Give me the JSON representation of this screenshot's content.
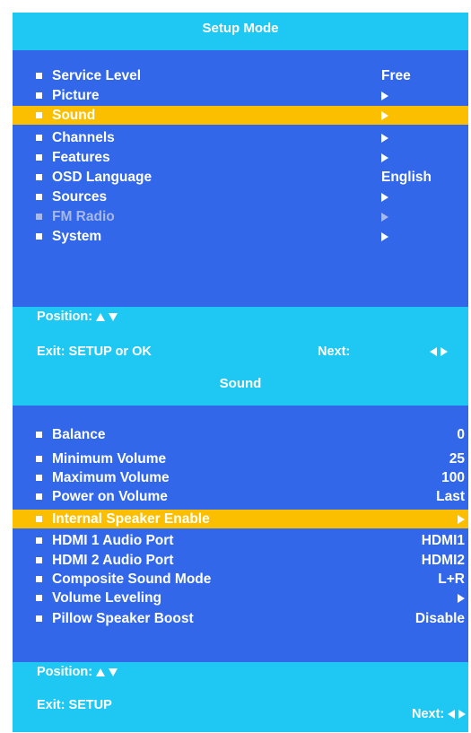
{
  "setup_menu": {
    "title": "Setup Mode",
    "items": [
      {
        "label": "Service Level",
        "value": "Free"
      },
      {
        "label": "Picture",
        "value": "",
        "arrow": true
      },
      {
        "label": "Sound",
        "value": "",
        "arrow": true,
        "selected": true
      },
      {
        "label": "Channels",
        "value": "",
        "arrow": true
      },
      {
        "label": "Features",
        "value": "",
        "arrow": true
      },
      {
        "label": "OSD Language",
        "value": "English"
      },
      {
        "label": "Sources",
        "value": "",
        "arrow": true
      },
      {
        "label": "FM Radio",
        "value": "",
        "arrow": true,
        "disabled": true
      },
      {
        "label": "System",
        "value": "",
        "arrow": true
      }
    ],
    "footer": {
      "position_label": "Position:",
      "exit_label": "Exit: SETUP or OK",
      "next_label": "Next:"
    }
  },
  "sound_menu": {
    "title": "Sound",
    "items": [
      {
        "label": "Balance",
        "value": "0"
      },
      {
        "label": "Minimum Volume",
        "value": "25"
      },
      {
        "label": "Maximum Volume",
        "value": "100"
      },
      {
        "label": "Power on Volume",
        "value": "Last"
      },
      {
        "label": "Internal Speaker Enable",
        "value": "",
        "arrow": true,
        "selected": true
      },
      {
        "label": "HDMI 1 Audio Port",
        "value": "HDMI1"
      },
      {
        "label": "HDMI 2 Audio Port",
        "value": "HDMI2"
      },
      {
        "label": "Composite Sound Mode",
        "value": "L+R"
      },
      {
        "label": "Volume Leveling",
        "value": "",
        "arrow": true
      },
      {
        "label": "Pillow Speaker Boost",
        "value": "Disable"
      }
    ],
    "footer": {
      "position_label": "Position:",
      "exit_label": "Exit: SETUP",
      "next_label": "Next:"
    }
  },
  "colors": {
    "header": "#1fc8f2",
    "body": "#3167e8",
    "highlight": "#fcbf00",
    "disabled_text": "#a8b8e8"
  }
}
